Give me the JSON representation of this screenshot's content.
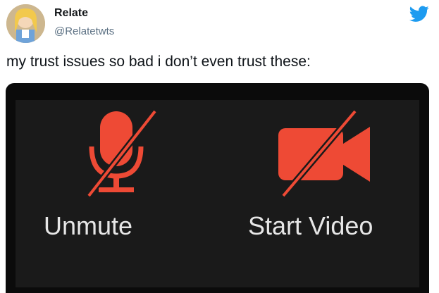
{
  "tweet": {
    "author_name": "Relate",
    "author_handle": "@Relatetwts",
    "text": "my trust issues so bad i don’t even trust these:"
  },
  "icons": {
    "brand": "twitter-bird-icon",
    "mic": "microphone-muted-icon",
    "camera": "video-camera-off-icon"
  },
  "colors": {
    "accent": "#1d9bf0",
    "icon_red": "#ee4a35",
    "media_bg": "#0b0b0b",
    "panel_bg": "#1a1a1a",
    "label_text": "#e6e6e6"
  },
  "media": {
    "unmute_label": "Unmute",
    "start_video_label": "Start Video"
  }
}
